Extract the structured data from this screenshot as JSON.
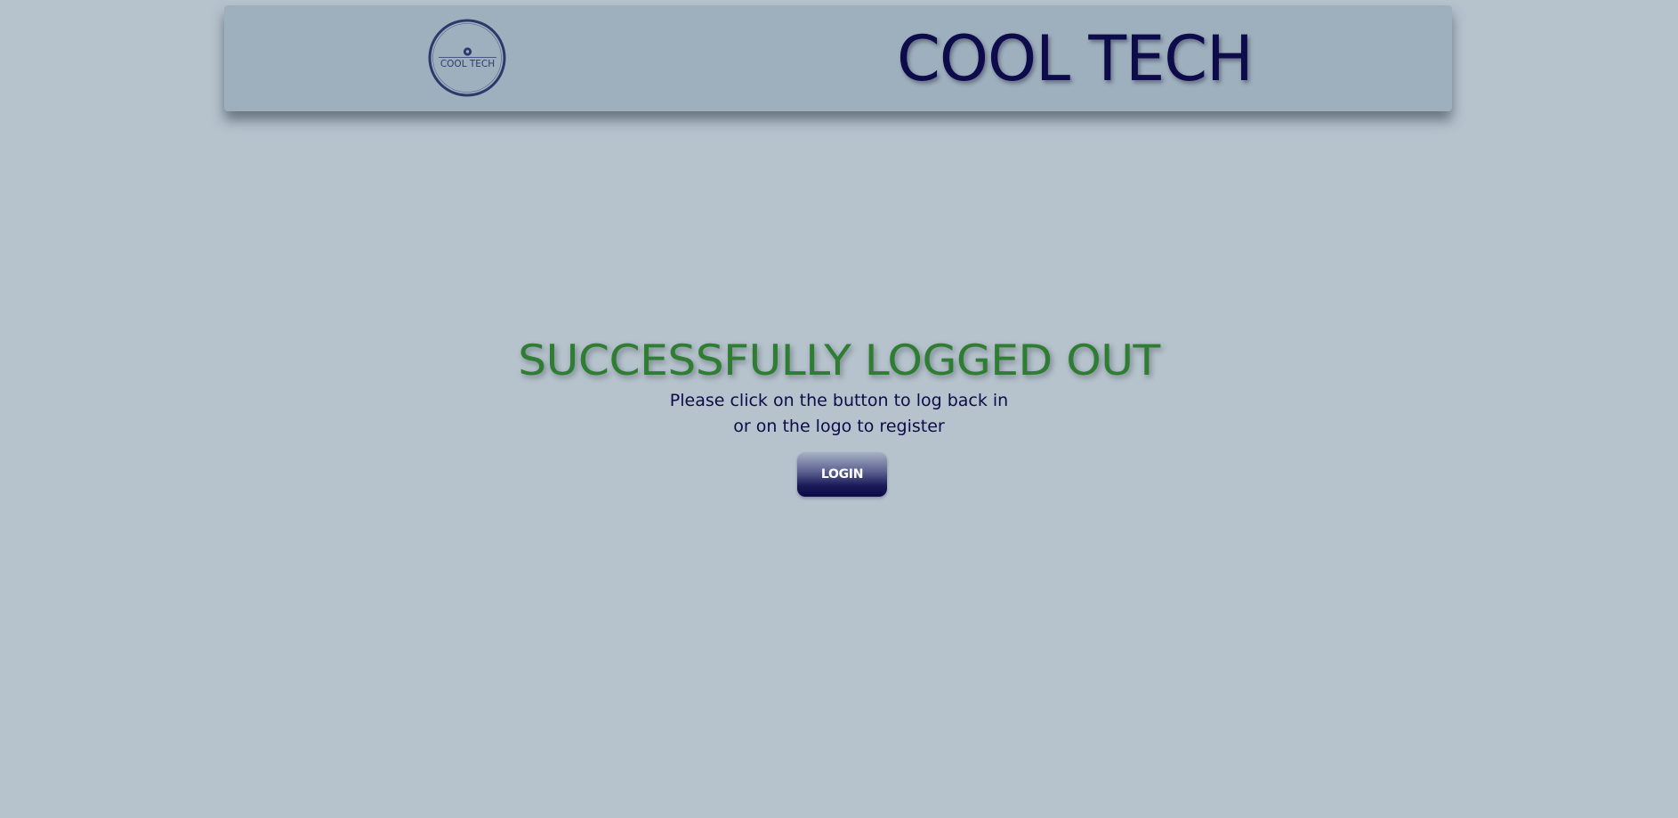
{
  "header": {
    "logo": {
      "icon": "cool-tech-logo",
      "text": "COOL TECH",
      "color": "#2b3a6b"
    },
    "title": "COOL TECH"
  },
  "main": {
    "status_title": "SUCCESSFULLY LOGGED OUT",
    "message_line_1": "Please click on the button to log back in",
    "message_line_2": "or on the logo to register",
    "login_button_label": "LOGIN"
  },
  "colors": {
    "background": "#b6c3cd",
    "header_background": "#9eb0be",
    "title_navy": "#0d0b4a",
    "success_green": "#2e7d32",
    "button_dark": "#0b0a45"
  }
}
